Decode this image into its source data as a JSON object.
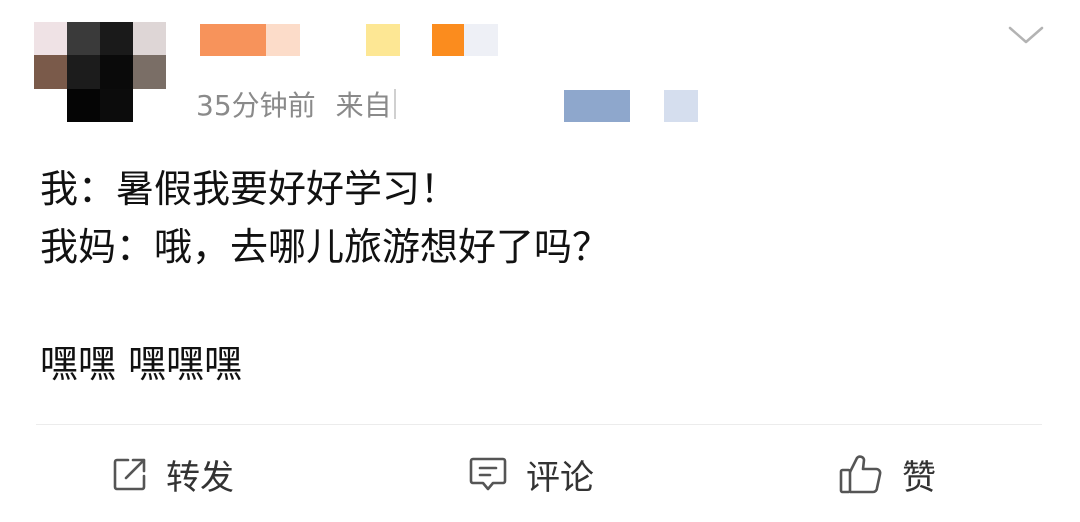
{
  "post": {
    "time": "35分钟前",
    "source_prefix": "来自",
    "content_lines": [
      "我：暑假我要好好学习！",
      "我妈：哦，去哪儿旅游想好了吗？"
    ],
    "content_tail": "嘿嘿 嘿嘿嘿"
  },
  "actions": {
    "repost": "转发",
    "comment": "评论",
    "like": "赞"
  },
  "icons": {
    "more": "chevron-down-icon",
    "repost": "share-icon",
    "comment": "comment-icon",
    "like": "thumbs-up-icon"
  },
  "colors": {
    "text": "#111111",
    "meta": "#8a8a8a",
    "action": "#333333"
  }
}
